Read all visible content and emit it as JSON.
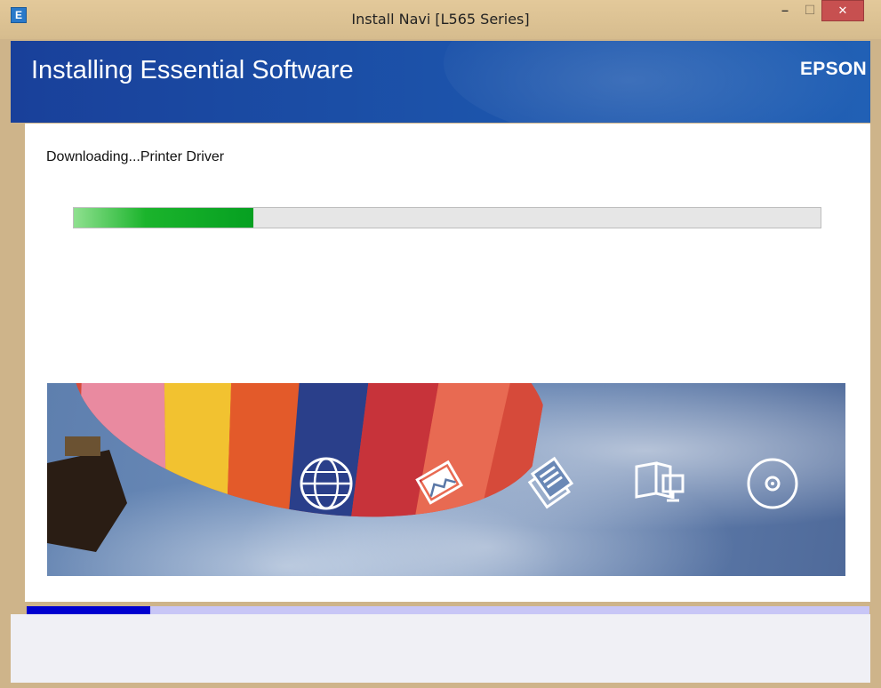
{
  "window": {
    "title": "Install Navi [L565 Series]",
    "app_icon_letter": "E",
    "min_glyph": "–",
    "max_glyph": "☐",
    "close_glyph": "✕"
  },
  "header": {
    "title": "Installing Essential Software",
    "brand": "EPSON"
  },
  "status": {
    "text": "Downloading...Printer Driver",
    "progress_fraction": 0.24
  },
  "overall_progress": {
    "fraction": 0.147
  },
  "banner": {
    "icons": [
      "globe-icon",
      "photo-icon",
      "documents-icon",
      "manual-icon",
      "disc-icon"
    ]
  },
  "colors": {
    "header_blue": "#1c54ab",
    "progress_green": "#1bb42c",
    "overall_blue": "#0000d0",
    "overall_track": "#c8c6f6",
    "close_red": "#c75050"
  }
}
